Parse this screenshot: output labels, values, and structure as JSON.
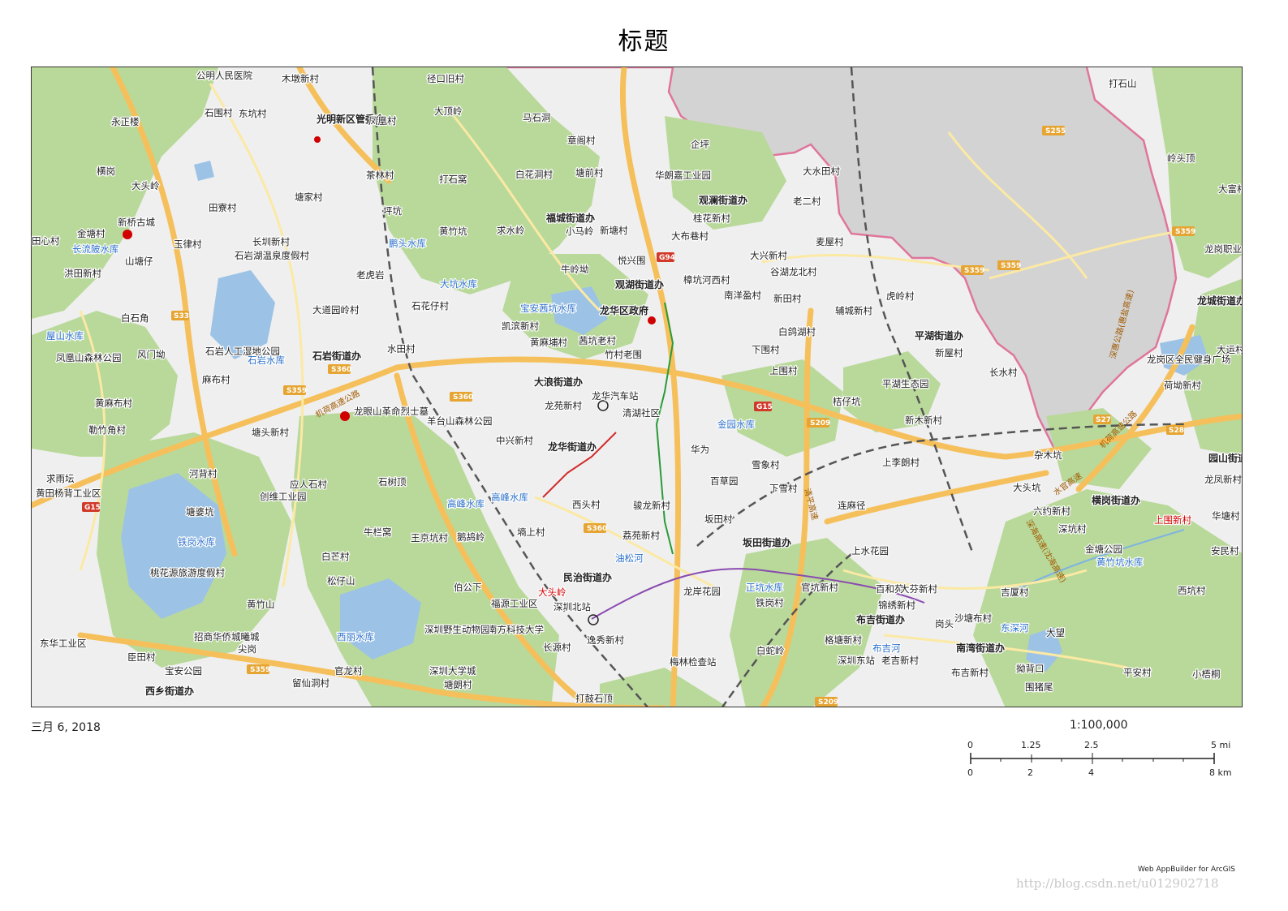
{
  "title": "标题",
  "date": "三月 6, 2018",
  "scale_text": "1:100,000",
  "scalebar": {
    "mi_labels": [
      "0",
      "1.25",
      "2.5",
      "5 mi"
    ],
    "km_labels": [
      "0",
      "2",
      "4",
      "8 km"
    ]
  },
  "credit": "Web AppBuilder for ArcGIS",
  "watermark": "http://blog.csdn.net/u012902718",
  "colors": {
    "land": "#efefef",
    "green": "#b9d99a",
    "water": "#9cc3e6",
    "road_major": "#f5c05b",
    "road_minor": "#fbe9a4",
    "outside_area": "#d3d3d3",
    "boundary": "#e0759c"
  },
  "map_labels": {
    "gongming": "公明人民医院",
    "mudunfang": "木墩新村",
    "yikou": "径口旧村",
    "dadingling": "大顶岭",
    "mashidong": "马石洞",
    "zhanghuashan": "章阁村",
    "qipa": "企坪",
    "dashuitian": "大水田村",
    "dashishan": "打石山",
    "yongzheng": "永正楼",
    "shiwei": "石围村",
    "dongkeng": "东坑村",
    "guangming_gov": "光明新区管委会",
    "fenghuang": "凤凰村",
    "chamucun": "茶林村",
    "dashiwo": "打石窝",
    "baihua": "白花洞村",
    "tangqian": "塘前村",
    "huahu": "华朗嘉工业园",
    "guanlan_jd": "观澜街道办",
    "laoercun": "老二村",
    "lingshan": "岭头顶",
    "dafuhao": "大富村",
    "henggang": "横岗",
    "datouling": "大头岭",
    "tianliao": "田寮村",
    "tangjia": "塘家村",
    "pingkeng": "坪坑",
    "huangzhuling": "黄竹坑",
    "qiushuiling": "求水岭",
    "fucheng_jd": "福城街道办",
    "xiaomaling": "小马岭",
    "xintangcun": "新塘村",
    "guihua": "桂花新村",
    "jintang": "金塘村",
    "xinqiaocheng": "新桥古城",
    "changliubei_reservoir": "长流陂水库",
    "yulv": "玉律村",
    "changchuan": "长圳新村",
    "pengtou_reservoir": "鹏头水库",
    "tianxin": "田心村",
    "dabuxiang": "大布巷村",
    "damianjiao": "麦屋村",
    "longgang_vocational": "龙岗职业技术学校",
    "shantang": "山塘仔",
    "shiyan_lake": "石岩湖温泉度假村",
    "laohu": "老虎岩",
    "niuling": "牛岭坳",
    "yuexing": "悦兴围",
    "daxingxin": "大兴新村",
    "gu_hu": "谷湖龙北村",
    "hongtian": "洪田新村",
    "dakeng_reservoir": "大坑水库",
    "guanhu_jd": "观湖街道办",
    "hengkeng": "樟坑河西村",
    "nanyang": "南洋盈村",
    "xintian": "新田村",
    "fucheng_new": "辅城新村",
    "hulin": "虎岭村",
    "longcheng_jd": "龙城街道办",
    "baishi": "白石角",
    "datu": "大道园岭村",
    "shihua": "石花仔村",
    "baoan_reservoir": "宝安茜坑水库",
    "longhua_gov": "龙华区政府",
    "baige": "白鸽湖村",
    "pinghu_jd": "平湖街道办",
    "wushan_reservoir": "屋山水库",
    "kaibin": "凯滨新村",
    "huangpu": "黄麻埔村",
    "maokeng": "茜坑老村",
    "fengmen": "风门坳",
    "shiyan_wetland": "石岩人工湿地公园",
    "shiyan_reservoir": "石岩水库",
    "shuitian": "水田村",
    "zhucun": "竹村老围",
    "xiawei": "下围村",
    "xinwu": "新屋村",
    "dayun": "大运村",
    "fenghuangshan": "凤凰山森林公园",
    "maling": "麻布村",
    "shiyan_jd": "石岩街道办",
    "dalang_jd": "大浪街道办",
    "shangwei": "上围村",
    "changshui": "长水村",
    "longgang_square": "龙岗区全民健身广场",
    "hebo": "荷坳新村",
    "huangma": "黄麻布村",
    "longyan": "龙眼山革命烈士墓",
    "longhua_bus": "龙华汽车站",
    "longyuan": "龙苑新村",
    "qinghu": "清湖社区",
    "jingui": "桔仔坑",
    "pinghu_eco": "平湖生态园",
    "lezhu": "勒竹角村",
    "tangtou": "塘头新村",
    "yangtai": "羊台山森林公园",
    "zhongxing": "中兴新村",
    "jinyuan_reservoir": "金园水库",
    "xinmu": "新木新村",
    "huawei": "华为",
    "longhua_jd": "龙华街道办",
    "yuanshan_jd": "园山街道办",
    "qiuyu": "求雨坛",
    "huangtian": "黄田杨背工业区",
    "hebei": "河背村",
    "yingrenshi": "应人石村",
    "shishu": "石树顶",
    "gaofeng_reservoir": "高峰水库",
    "gaofeng_reservoir2": "高峰水库",
    "xuexiang": "雪象村",
    "shangli": "上李朗村",
    "zamukeng": "杂木坑",
    "datoukeng": "大头坑",
    "longfeng": "龙凤新村",
    "chuangwei": "创维工业园",
    "xitou": "西头村",
    "junfa": "骏龙新村",
    "baicaoyuan": "百草园",
    "xiaxue": "下雪村",
    "lianjing": "连麻径",
    "henggang_jd": "横岗街道办",
    "tangpo": "塘婆坑",
    "niulanwo": "牛栏窝",
    "shangtanggu": "墒上村",
    "bantian": "坂田村",
    "liuyue": "六约新村",
    "shenkeng": "深坑村",
    "shangwei_new": "上围新村",
    "huatang": "华塘村",
    "tiegang_reservoir": "铁岗水库",
    "wangjing": "王京坑村",
    "yuguling": "鹅鸪岭",
    "liyuan": "荔苑新村",
    "bantian_jd": "坂田街道办",
    "anmin": "安民村",
    "baimang": "白芒村",
    "youlanghe": "油松河",
    "shangshui": "上水花园",
    "jintang_park": "金塘公园",
    "huangzhu_reservoir": "黄竹坑水库",
    "taohua": "桃花源旅游度假村",
    "songzi": "松仔山",
    "bolong": "伯公下",
    "minzhi_jd": "民治街道办",
    "zhengkeng_reservoir": "正坑水库",
    "guanpai": "官坑新村",
    "baihe": "百和苑",
    "dafen": "大芬新村",
    "jixia": "吉厦村",
    "xikeng": "西坑村",
    "huangzhu": "黄竹山",
    "fuyuan": "福源工业区",
    "datouling2": "大头岭",
    "longan": "龙岸花园",
    "tiegang": "铁岗村",
    "nanfang": "南方科技大学",
    "shenzhen_north": "深圳北站",
    "gangtou": "岗头",
    "jinxiu": "锦绣新村",
    "buji_jd": "布吉街道办",
    "shaxia": "沙塘布村",
    "dongshen": "东深河",
    "dawang": "大望",
    "dongtou": "东华工业区",
    "chentian": "臣田村",
    "zhaoshang": "招商华侨城曦城",
    "jiangang": "尖岗",
    "xilihu": "西丽水库",
    "shenzhen_zoo": "深圳野生动物园",
    "changyuan": "长源村",
    "yixiu": "逸秀新村",
    "baishe": "白蛇岭",
    "gege": "格塘新村",
    "shenzhen_east": "深圳东站",
    "bujihe": "布吉河",
    "laojicun": "老吉新村",
    "nanwan_jd": "南湾街道办",
    "baoan_park": "宝安公园",
    "meilin": "梅林检查站",
    "shenzhen_univ": "深圳大学城",
    "tangliang": "塘朗村",
    "guanlong": "官龙村",
    "liuxian": "留仙洞村",
    "xixiang_jd": "西乡街道办",
    "dakou": "打鼓石顶",
    "bujixin": "布吉新村",
    "pingan": "平安村",
    "xiaomeng": "小梧桐",
    "goudu": "拗背口",
    "zhuzhu": "围猪尾"
  },
  "road_labels": {
    "jihe": "机荷高速公路",
    "jihe2": "机荷高速公路",
    "shuiguan": "水官高速",
    "qingping": "清平高速",
    "shenhui": "深惠公路(惠盐高速)",
    "longda": "龙大高速",
    "danping": "丹平快速",
    "shenhai": "深海高速(沈海高速)"
  },
  "road_shields": {
    "s255": "S255",
    "s359a": "S359",
    "s359b": "S359",
    "s359c": "S359",
    "g94": "G94",
    "s33": "S33",
    "s360a": "S360",
    "s360b": "S360",
    "s360c": "S360",
    "g15a": "G15",
    "g15b": "G15",
    "s209a": "S209",
    "s209b": "S209",
    "s27": "S27",
    "s28": "S28",
    "s359d": "S359",
    "s359e": "S359"
  }
}
